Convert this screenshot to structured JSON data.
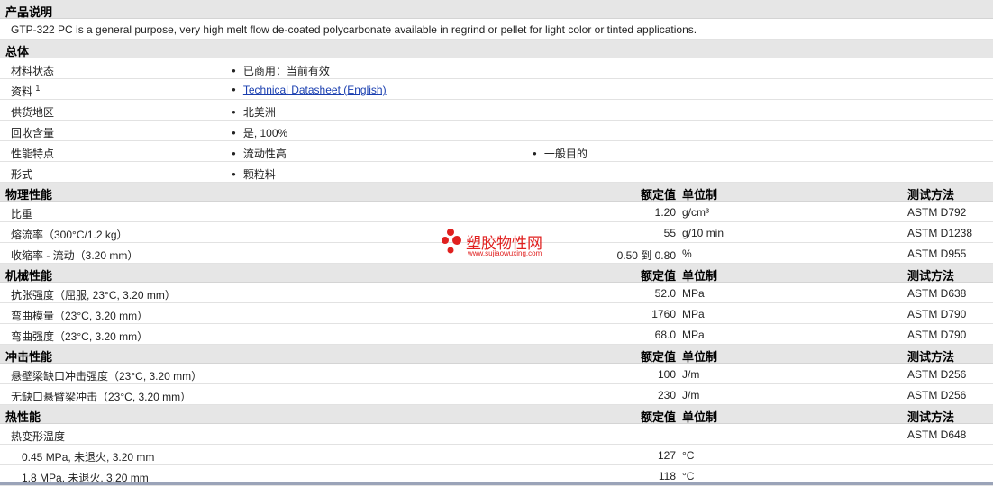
{
  "desc_title": "产品说明",
  "desc_text": "GTP-322 PC is a general purpose, very high melt flow de-coated polycarbonate available in regrind or pellet for light color or tinted applications.",
  "general": {
    "title": "总体",
    "rows": [
      {
        "label": "材料状态",
        "v1": "已商用：当前有效"
      },
      {
        "label": "资料",
        "sup": "1",
        "link": "Technical Datasheet (English)"
      },
      {
        "label": "供货地区",
        "v1": "北美洲"
      },
      {
        "label": "回收含量",
        "v1": "是, 100%"
      },
      {
        "label": "性能特点",
        "v1": "流动性高",
        "v2": "一般目的"
      },
      {
        "label": "形式",
        "v1": "颗粒料"
      }
    ]
  },
  "col_value": "额定值",
  "col_unit": "单位制",
  "col_method": "测试方法",
  "physical": {
    "title": "物理性能",
    "rows": [
      {
        "label": "比重",
        "value": "1.20",
        "unit": "g/cm³",
        "method": "ASTM D792"
      },
      {
        "label": "熔流率（300°C/1.2 kg）",
        "value": "55",
        "unit": "g/10 min",
        "method": "ASTM D1238"
      },
      {
        "label": "收缩率 - 流动（3.20 mm）",
        "value": "0.50 到 0.80",
        "unit": "%",
        "method": "ASTM D955"
      }
    ]
  },
  "mechanical": {
    "title": "机械性能",
    "rows": [
      {
        "label": "抗张强度（屈服, 23°C, 3.20 mm）",
        "value": "52.0",
        "unit": "MPa",
        "method": "ASTM D638"
      },
      {
        "label": "弯曲模量（23°C, 3.20 mm）",
        "value": "1760",
        "unit": "MPa",
        "method": "ASTM D790"
      },
      {
        "label": "弯曲强度（23°C, 3.20 mm）",
        "value": "68.0",
        "unit": "MPa",
        "method": "ASTM D790"
      }
    ]
  },
  "impact": {
    "title": "冲击性能",
    "rows": [
      {
        "label": "悬壁梁缺口冲击强度（23°C, 3.20 mm）",
        "value": "100",
        "unit": "J/m",
        "method": "ASTM D256"
      },
      {
        "label": "无缺口悬臂梁冲击（23°C, 3.20 mm）",
        "value": "230",
        "unit": "J/m",
        "method": "ASTM D256"
      }
    ]
  },
  "thermal": {
    "title": "热性能",
    "rows": [
      {
        "label": "热变形温度",
        "value": "",
        "unit": "",
        "method": "ASTM D648"
      },
      {
        "label": "0.45 MPa, 未退火, 3.20 mm",
        "value": "127",
        "unit": "°C",
        "method": ""
      },
      {
        "label": "1.8 MPa, 未退火, 3.20 mm",
        "value": "118",
        "unit": "°C",
        "method": ""
      }
    ]
  },
  "watermark": {
    "name": "塑胶物性网",
    "url": "www.sujiaowuxing.com",
    "color": "#e0201f"
  }
}
